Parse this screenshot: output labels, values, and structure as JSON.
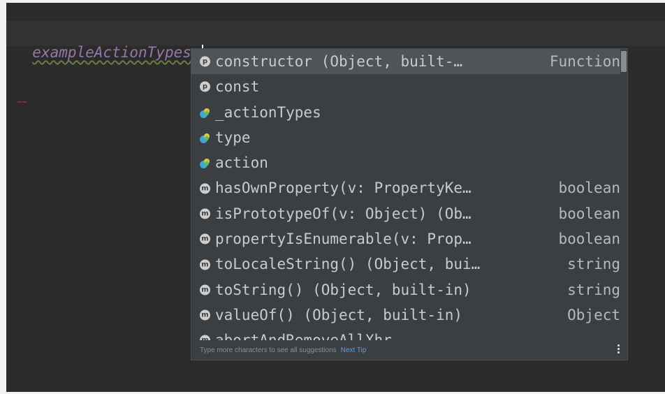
{
  "editor": {
    "identifier": "exampleActionTypes",
    "dot": ".",
    "gutter_mark": "~~"
  },
  "completion": {
    "items": [
      {
        "icon": "p",
        "icon_name": "property-icon",
        "label": "constructor (Object, built-…",
        "type": "Function",
        "selected": true
      },
      {
        "icon": "p",
        "icon_name": "property-icon",
        "label": "const",
        "type": ""
      },
      {
        "icon": "",
        "icon_name": "variable-icon",
        "label": "_actionTypes",
        "type": ""
      },
      {
        "icon": "",
        "icon_name": "variable-icon",
        "label": "type",
        "type": ""
      },
      {
        "icon": "",
        "icon_name": "variable-icon",
        "label": "action",
        "type": ""
      },
      {
        "icon": "m",
        "icon_name": "method-icon",
        "label": "hasOwnProperty(v: PropertyKe…",
        "type": "boolean"
      },
      {
        "icon": "m",
        "icon_name": "method-icon",
        "label": "isPrototypeOf(v: Object) (Ob…",
        "type": "boolean"
      },
      {
        "icon": "m",
        "icon_name": "method-icon",
        "label": "propertyIsEnumerable(v: Prop…",
        "type": "boolean"
      },
      {
        "icon": "m",
        "icon_name": "method-icon",
        "label": "toLocaleString() (Object, bui…",
        "type": "string"
      },
      {
        "icon": "m",
        "icon_name": "method-icon",
        "label": "toString() (Object, built-in)",
        "type": "string"
      },
      {
        "icon": "m",
        "icon_name": "method-icon",
        "label": "valueOf() (Object, built-in)",
        "type": "Object"
      },
      {
        "icon": "m",
        "icon_name": "method-icon",
        "label": "abortAndRemoveAllXhr",
        "type": ""
      }
    ],
    "footer": {
      "hint": "Type more characters to see all suggestions",
      "link": "Next Tip"
    }
  },
  "colors": {
    "background": "#2b2b2b",
    "popup": "#3c3f41",
    "selection": "#4f5458",
    "identifier": "#9876aa",
    "link": "#589df6"
  }
}
